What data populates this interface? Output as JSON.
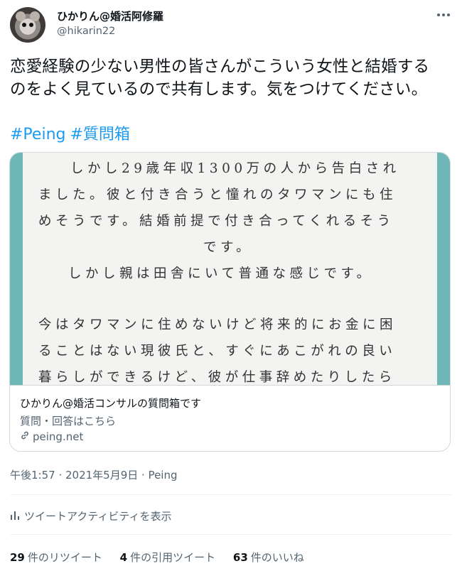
{
  "user": {
    "display_name": "ひかりん@婚活阿修羅",
    "handle": "@hikarin22"
  },
  "menu_icon": "more-icon",
  "tweet": {
    "text_lines": [
      "恋愛経験の少ない男性の皆さんがこういう女性と結婚する",
      "のをよく見ているので共有します。気をつけてください。"
    ],
    "hashtags": [
      "#Peing",
      "#質問箱"
    ]
  },
  "card": {
    "image_text_lines": [
      "しかし29歳年収1300万の人から告白され",
      "ました。彼と付き合うと憧れのタワマンにも住",
      "めそうです。結婚前提で付き合ってくれるそう",
      "です。",
      "しかし親は田舎にいて普通な感じです。",
      "今はタワマンに住めないけど将来的にお金に困",
      "ることはない現彼氏と、すぐにあこがれの良い",
      "暮らしができるけど、彼が仕事辞めたりしたら"
    ],
    "accent_color": "#6fb7b6",
    "title": "ひかりん@婚活コンサルの質問箱です",
    "description": "質問・回答はこちら",
    "link": "peing.net",
    "link_icon": "link-icon"
  },
  "meta": {
    "timestamp": "午後1:57 · 2021年5月9日 · Peing"
  },
  "activity": {
    "label": "ツイートアクティビティを表示",
    "icon": "bar-chart-icon"
  },
  "stats": {
    "retweets": {
      "count": "29",
      "label": "件のリツイート"
    },
    "quotes": {
      "count": "4",
      "label": "件の引用ツイート"
    },
    "likes": {
      "count": "63",
      "label": "件のいいね"
    }
  }
}
